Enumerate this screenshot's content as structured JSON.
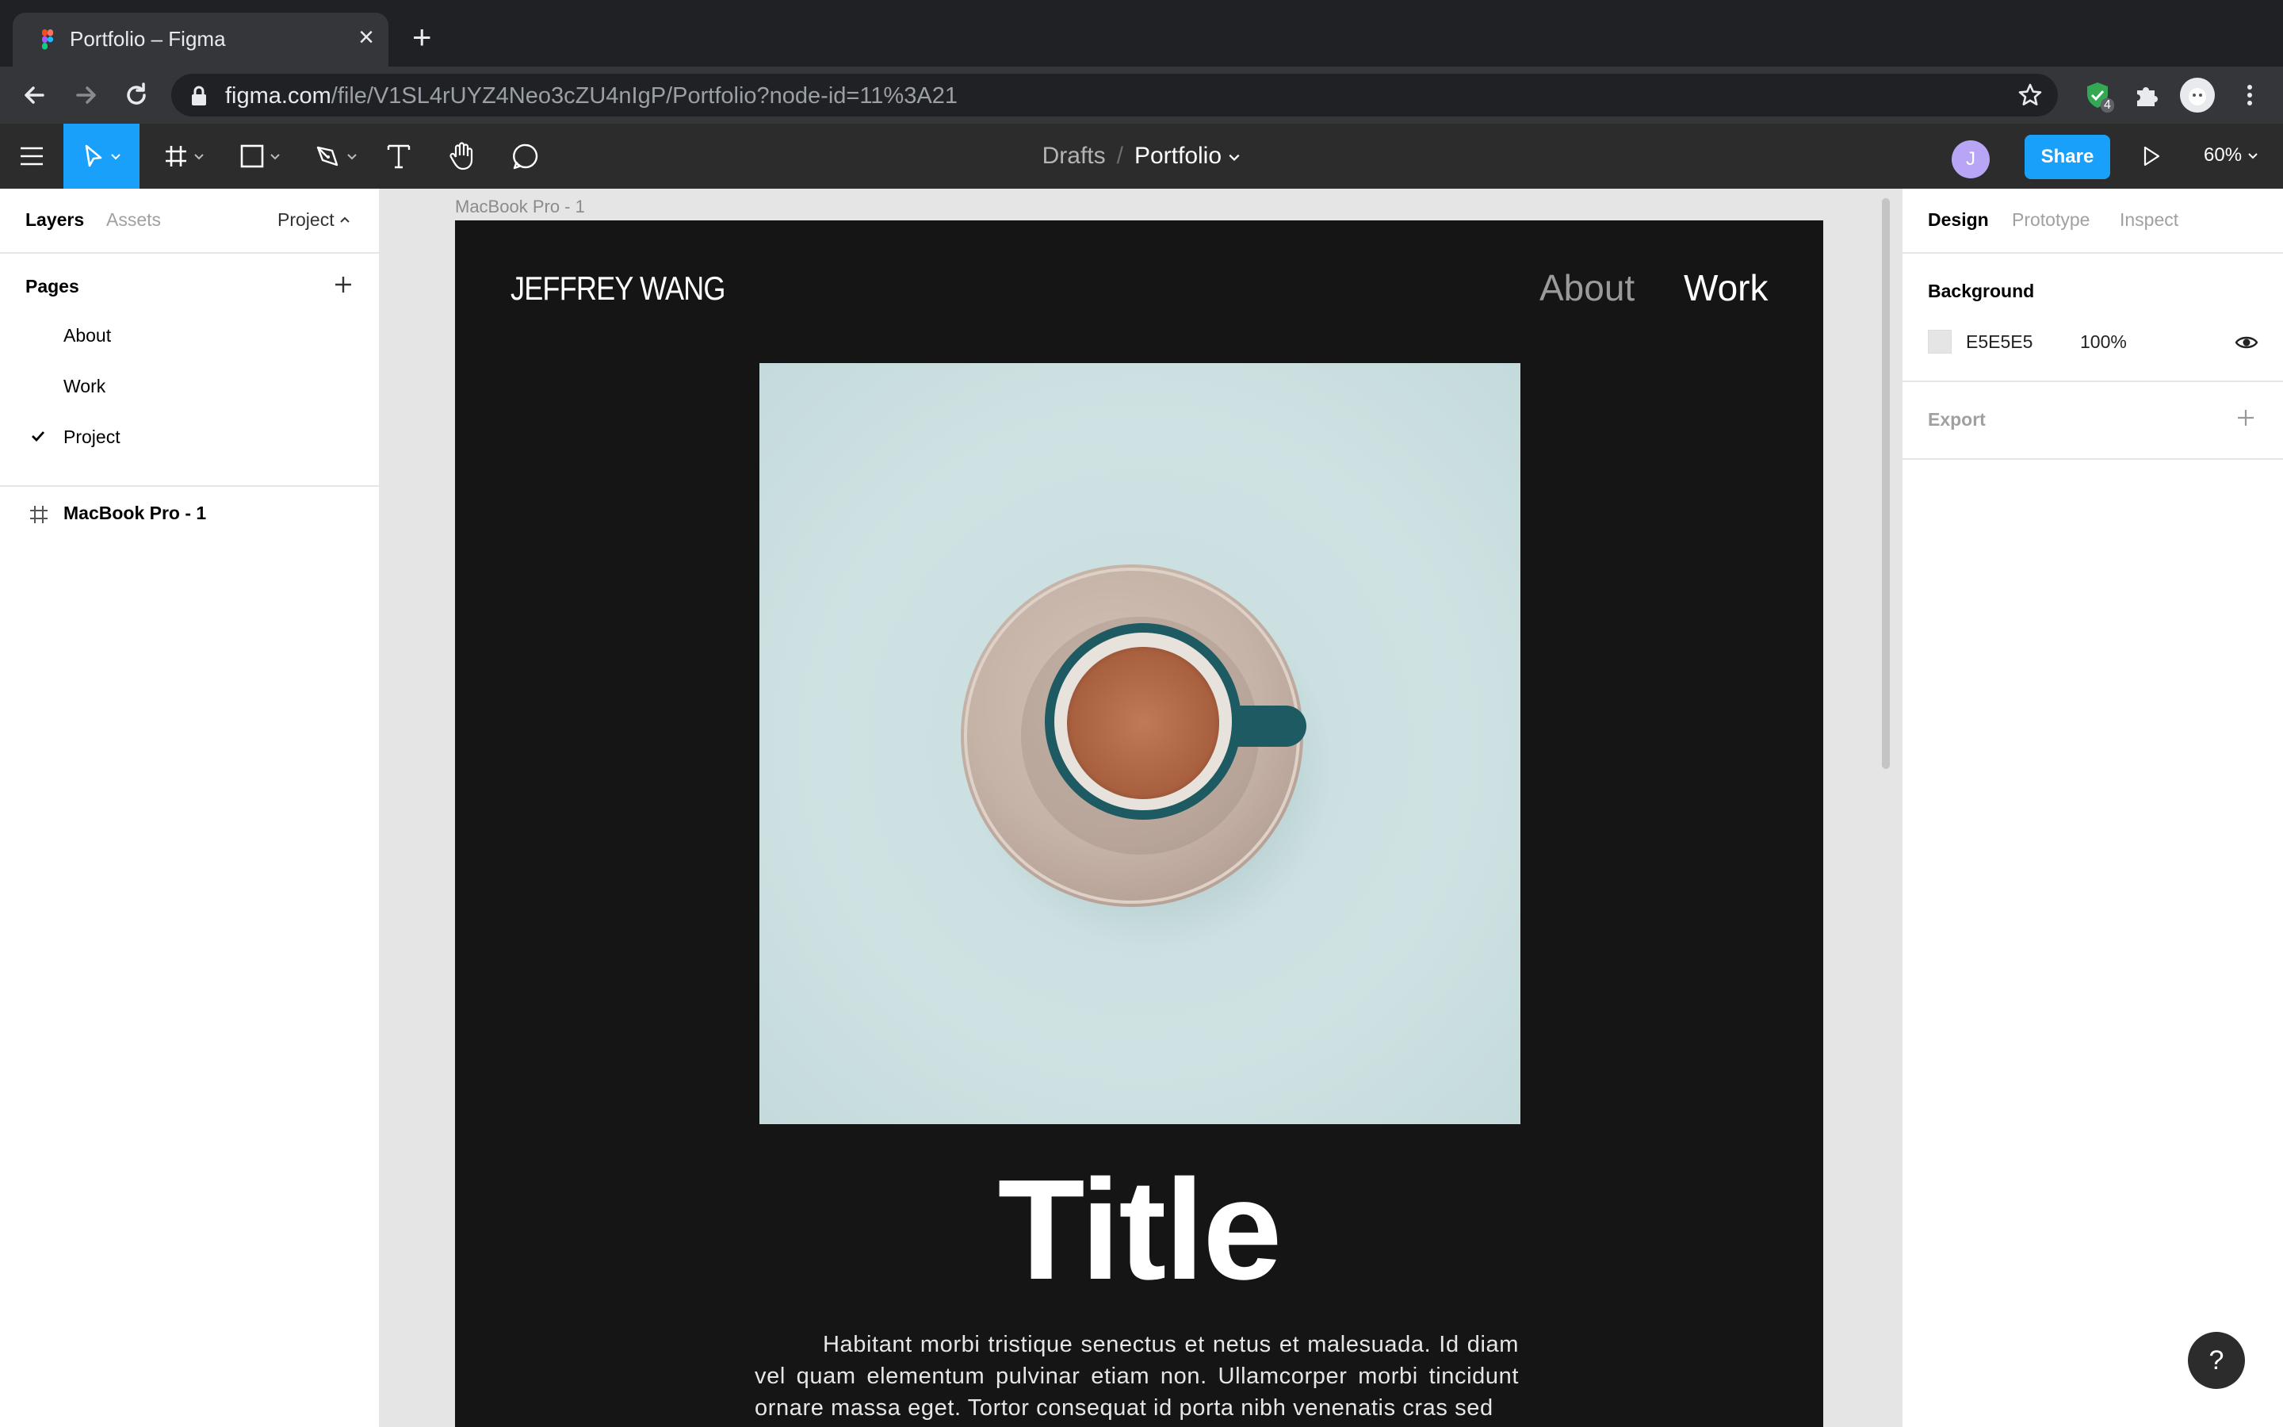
{
  "browser": {
    "tab_title": "Portfolio – Figma",
    "url_host": "figma.com",
    "url_path": "/file/V1SL4rUYZ4Neo3cZU4nIgP/Portfolio?node-id=11%3A21",
    "extension_badge": "4"
  },
  "toolbar": {
    "breadcrumb_parent": "Drafts",
    "breadcrumb_separator": "/",
    "file_name": "Portfolio",
    "avatar_initial": "J",
    "share_label": "Share",
    "zoom_level": "60%",
    "accent_color": "#18a0fb"
  },
  "left_panel": {
    "tabs": [
      "Layers",
      "Assets"
    ],
    "current_page_selector": "Project",
    "pages_header": "Pages",
    "pages": [
      "About",
      "Work",
      "Project"
    ],
    "selected_page": "Project",
    "layers": [
      "MacBook Pro - 1"
    ]
  },
  "canvas": {
    "frame_label": "MacBook Pro - 1",
    "site": {
      "brand": "JEFFREY WANG",
      "nav": [
        "About",
        "Work"
      ],
      "title": "Title",
      "body": "Habitant morbi tristique senectus et netus et malesuada. Id diam vel quam elementum pulvinar etiam non. Ullamcorper morbi tincidunt ornare massa eget. Tortor consequat id porta nibh venenatis cras sed"
    }
  },
  "right_panel": {
    "tabs": [
      "Design",
      "Prototype",
      "Inspect"
    ],
    "background_header": "Background",
    "background_hex": "E5E5E5",
    "background_opacity": "100%",
    "export_header": "Export",
    "background_color": "#e5e5e5"
  },
  "help_label": "?"
}
